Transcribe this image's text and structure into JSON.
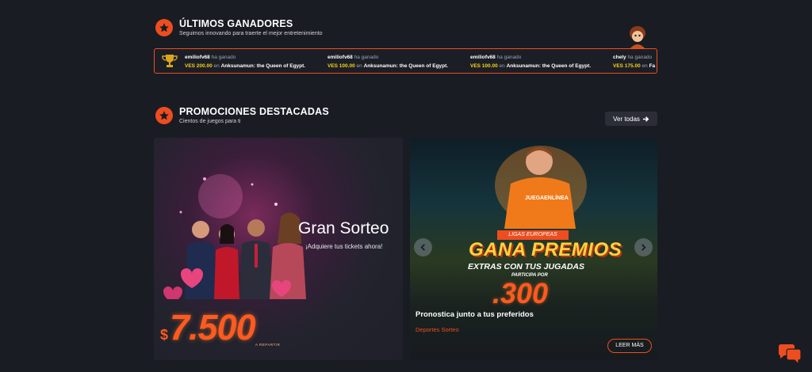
{
  "winners_section": {
    "title": "ÚLTIMOS GANADORES",
    "subtitle": "Seguimos innovando para traerte el mejor entretenimiento",
    "items": [
      {
        "user": "emiliofv68",
        "action": "ha ganado",
        "amount": "VES 200.00",
        "en": "en",
        "game": "Anksunamun: the Queen of Egypt."
      },
      {
        "user": "emiliofv68",
        "action": "ha ganado",
        "amount": "VES 100.00",
        "en": "en",
        "game": "Anksunamun: the Queen of Egypt."
      },
      {
        "user": "emiliofv68",
        "action": "ha ganado",
        "amount": "VES 100.00",
        "en": "en",
        "game": "Anksunamun: the Queen of Egypt."
      },
      {
        "user": "chely",
        "action": "ha ganado",
        "amount": "VES 175.00",
        "en": "en",
        "game": "Fa"
      }
    ]
  },
  "promos_section": {
    "title": "PROMOCIONES DESTACADAS",
    "subtitle": "Cientos de juegos para ti",
    "view_all": "Ver todas"
  },
  "promo_left": {
    "title": "Gran Sorteo",
    "subtitle": "¡Adquiere tus tickets ahora!",
    "currency": "$",
    "prize": "7.500",
    "prize_note": "A REPARTIR"
  },
  "promo_right": {
    "banner_tag": "LIGAS EUROPEAS",
    "headline": "GANA PREMIOS",
    "subheadline": "EXTRAS CON TUS JUGADAS",
    "participa": "PARTICIPA POR",
    "prize": ".300",
    "title": "Pronostica junto a tus preferidos",
    "category": "Deportes Sorteo",
    "button": "LEER MÁS",
    "shirt_text": "JUEGAENLÍNEA"
  },
  "colors": {
    "accent": "#ee4d1f",
    "background": "#1a1c23",
    "gold": "#f5d21a"
  },
  "icons": [
    "star-icon",
    "trophy-icon",
    "arrow-right-icon",
    "chevron-left-icon",
    "chevron-right-icon",
    "chat-icon"
  ]
}
